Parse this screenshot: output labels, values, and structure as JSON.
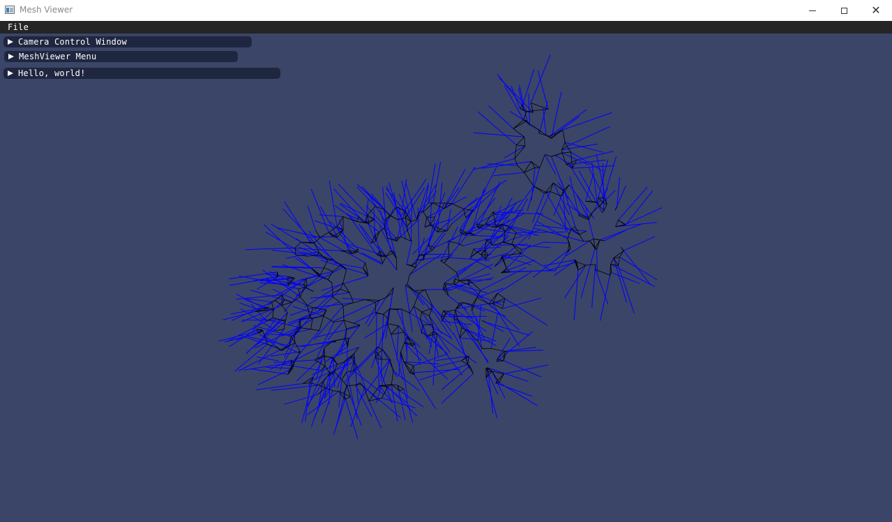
{
  "window": {
    "title": "Mesh Viewer",
    "icon": "app-window-icon",
    "controls": [
      "minimize-icon",
      "maximize-icon",
      "close-icon"
    ]
  },
  "menubar": {
    "items": [
      {
        "label": "File"
      }
    ]
  },
  "panels": [
    {
      "label": "Camera Control Window",
      "state": "collapsed"
    },
    {
      "label": "MeshViewer Menu",
      "state": "collapsed"
    },
    {
      "label": "Hello, world!",
      "state": "collapsed"
    }
  ],
  "viewport": {
    "subject": "wireframe bunny mesh with vertex normals",
    "colors": {
      "background": "#3b4567",
      "wireframe": "#000000",
      "normals": "#0000ff"
    }
  }
}
